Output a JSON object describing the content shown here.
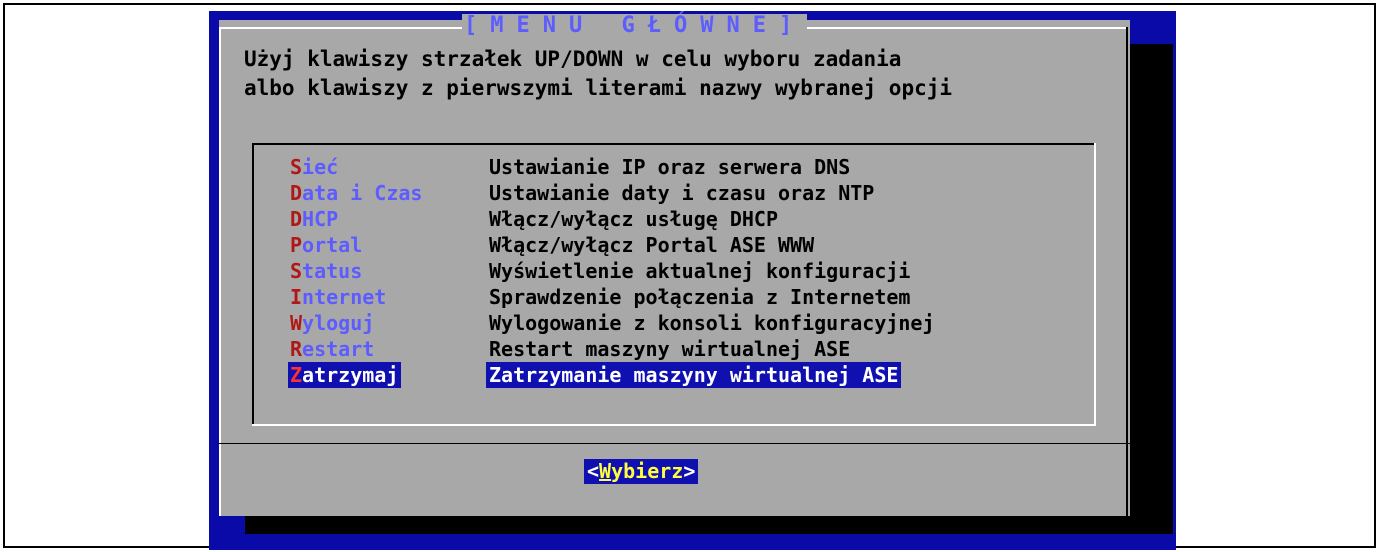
{
  "dialog": {
    "title": "[MENU GŁÓWNE]",
    "instruction_line1": "Użyj klawiszy strzałek UP/DOWN w celu wyboru zadania",
    "instruction_line2": "albo klawiszy z pierwszymi literami nazwy wybranej opcji"
  },
  "menu": {
    "items": [
      {
        "hotkey": "S",
        "rest": "ieć",
        "description": "Ustawianie IP oraz serwera DNS"
      },
      {
        "hotkey": "D",
        "rest": "ata i Czas",
        "description": "Ustawianie daty i czasu oraz NTP"
      },
      {
        "hotkey": "D",
        "rest": "HCP",
        "description": "Włącz/wyłącz usługę DHCP"
      },
      {
        "hotkey": "P",
        "rest": "ortal",
        "description": "Włącz/wyłącz Portal ASE WWW"
      },
      {
        "hotkey": "S",
        "rest": "tatus",
        "description": "Wyświetlenie aktualnej konfiguracji"
      },
      {
        "hotkey": "I",
        "rest": "nternet",
        "description": "Sprawdzenie połączenia z Internetem"
      },
      {
        "hotkey": "W",
        "rest": "yloguj",
        "description": "Wylogowanie z konsoli konfiguracyjnej"
      },
      {
        "hotkey": "R",
        "rest": "estart",
        "description": "Restart maszyny wirtualnej ASE"
      },
      {
        "hotkey": "Z",
        "rest": "atrzymaj",
        "description": "Zatrzymanie maszyny wirtualnej ASE"
      }
    ],
    "selected_index": 8
  },
  "button": {
    "open": "<",
    "hotkey": "W",
    "rest": "ybierz",
    "close": ">"
  },
  "colors": {
    "screen_background": "#0a0aa8",
    "dialog_background": "#a8a8a8",
    "menu_key": "#5c5cff",
    "menu_hotkey": "#b01818",
    "selection": "#1010b0"
  }
}
